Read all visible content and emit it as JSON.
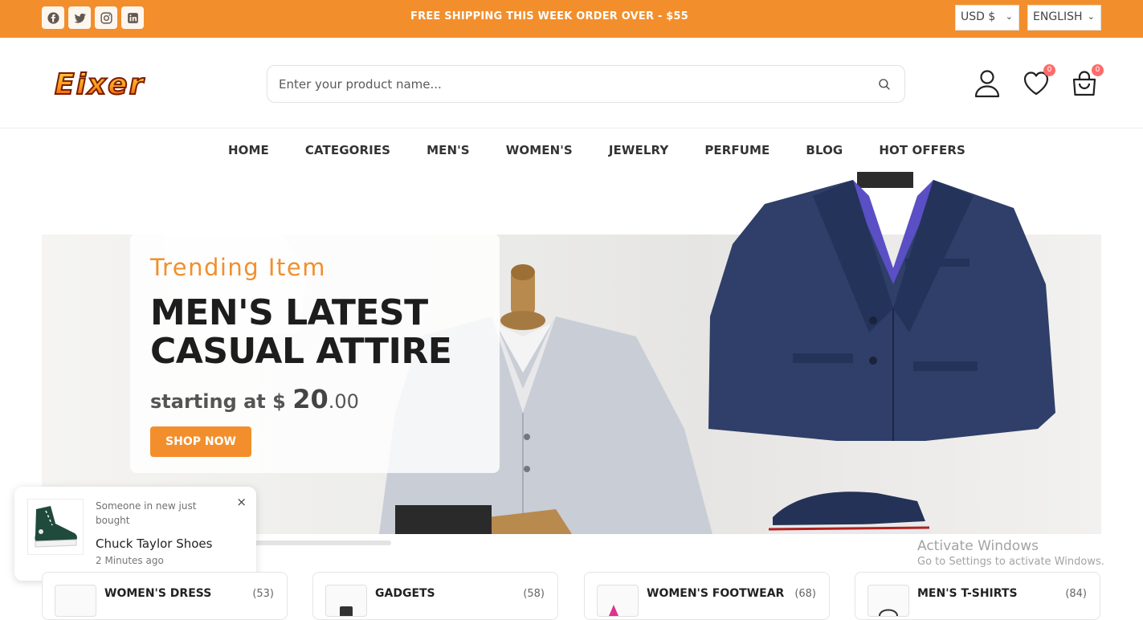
{
  "topbar": {
    "promo": "FREE SHIPPING THIS WEEK ORDER OVER - $55",
    "currency": "USD $",
    "language": "ENGLISH",
    "socials": [
      "facebook-icon",
      "twitter-icon",
      "instagram-icon",
      "linkedin-icon"
    ],
    "color": "#f28f2c"
  },
  "header": {
    "logo_text": "Eixer",
    "search_placeholder": "Enter your product name...",
    "wishlist_count": "0",
    "cart_count": "0"
  },
  "nav": {
    "items": [
      "HOME",
      "CATEGORIES",
      "MEN'S",
      "WOMEN'S",
      "JEWELRY",
      "PERFUME",
      "BLOG",
      "HOT OFFERS"
    ]
  },
  "hero": {
    "eyebrow": "Trending Item",
    "headline_line1": "MEN'S LATEST",
    "headline_line2": "CASUAL ATTIRE",
    "price_prefix": "starting at $",
    "price_whole": "20",
    "price_cents": ".00",
    "cta": "SHOP NOW"
  },
  "toast": {
    "subtitle": "Someone in new just bought",
    "product": "Chuck Taylor Shoes",
    "time": "2 Minutes ago",
    "close": "×"
  },
  "watermark": {
    "line1": "Activate Windows",
    "line2": "Go to Settings to activate Windows."
  },
  "categories": [
    {
      "name": "WOMEN'S DRESS",
      "count": "(53)"
    },
    {
      "name": "GADGETS",
      "count": "(58)"
    },
    {
      "name": "WOMEN'S FOOTWEAR",
      "count": "(68)"
    },
    {
      "name": "MEN'S T-SHIRTS",
      "count": "(84)"
    }
  ]
}
